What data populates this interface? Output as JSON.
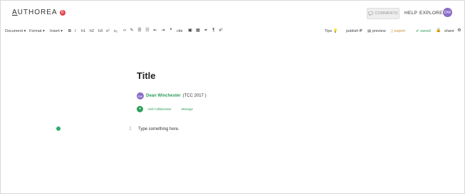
{
  "header": {
    "logo_first": "A",
    "logo_rest": "UTHOREA",
    "logo_badge": "0",
    "comments_label": "COMMENTS",
    "help_label": "HELP",
    "explore_label": "EXPLORE",
    "avatar_initials": "DW"
  },
  "toolbar": {
    "document_label": "Document",
    "format_label": "Format",
    "insert_label": "Insert",
    "bold": "B",
    "italic": "I",
    "h1": "h1",
    "h2": "h2",
    "h3": "h3",
    "superscript": "x²",
    "subscript": "x₂",
    "cite": "cite",
    "tips_label": "Tips",
    "publish_label": "publish",
    "preview_label": "preview",
    "export_label": "export",
    "saved_label": "saved",
    "share_label": "share"
  },
  "document": {
    "title": "Title",
    "author_initials": "DW",
    "author_name": "Dean Winchester",
    "author_affiliation": "(TCC 2017 )",
    "add_collaborator_label": "Add Collaborator",
    "manage_label": "Manage",
    "line_number": "1",
    "body_placeholder": "Type something here."
  }
}
